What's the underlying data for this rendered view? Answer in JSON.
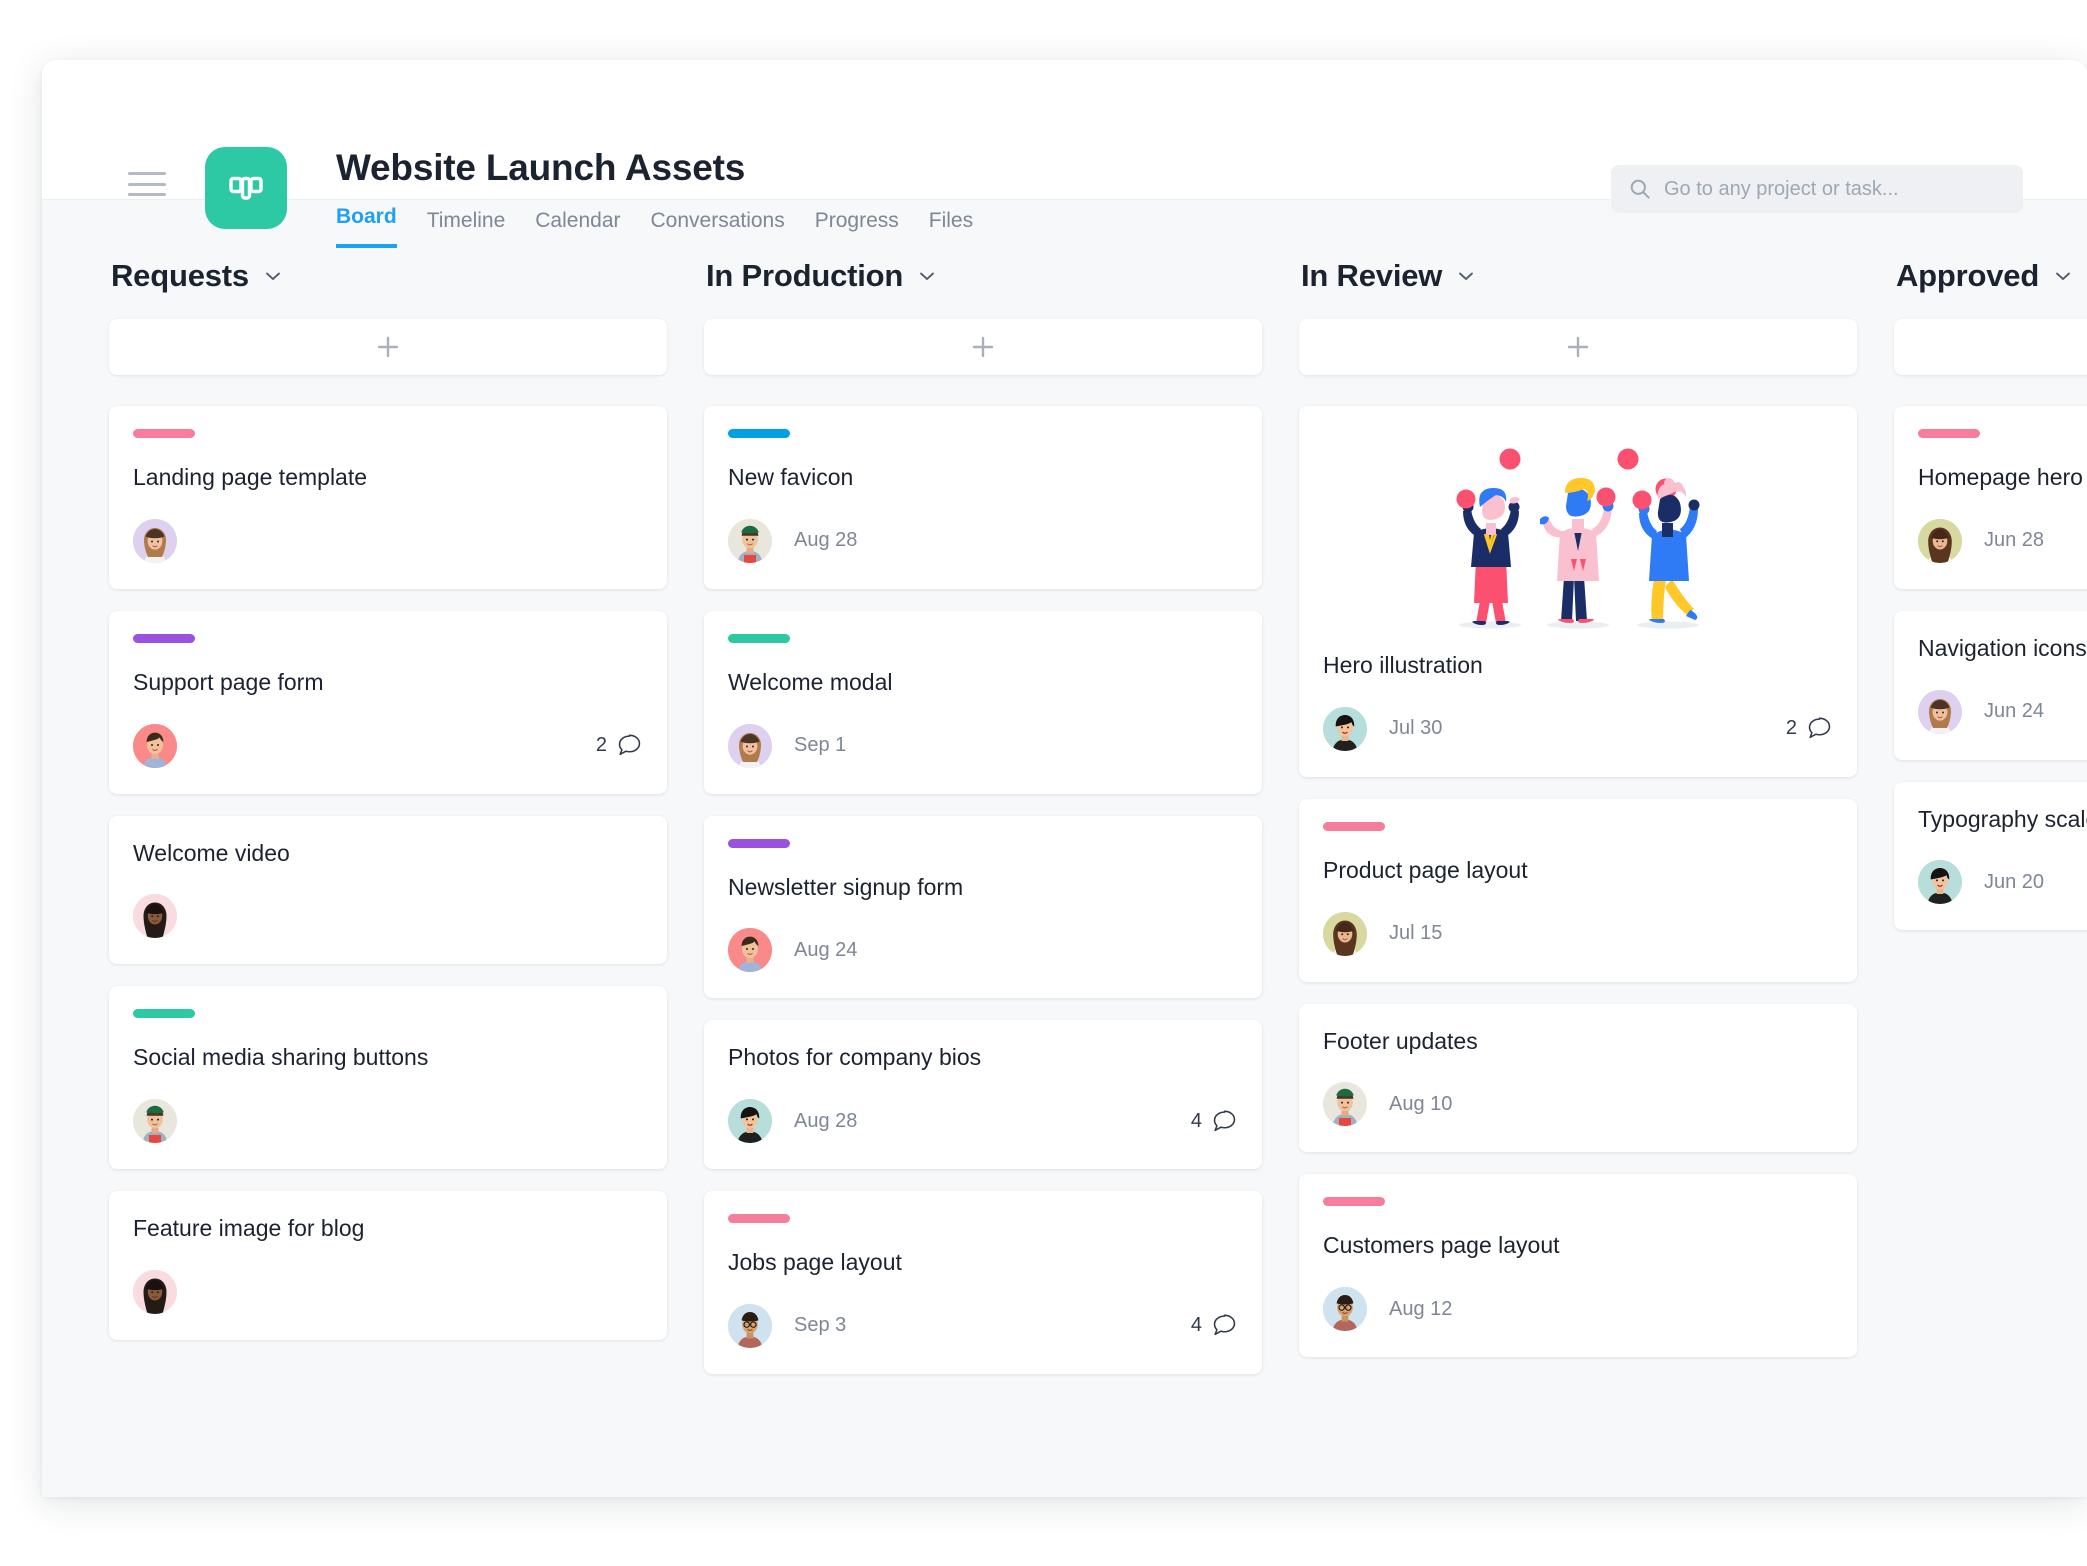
{
  "header": {
    "title": "Website Launch Assets",
    "menu_icon": "hamburger-icon",
    "project_icon": "board-icon",
    "tabs": [
      {
        "label": "Board",
        "active": true
      },
      {
        "label": "Timeline",
        "active": false
      },
      {
        "label": "Calendar",
        "active": false
      },
      {
        "label": "Conversations",
        "active": false
      },
      {
        "label": "Progress",
        "active": false
      },
      {
        "label": "Files",
        "active": false
      }
    ],
    "search": {
      "icon": "search-icon",
      "placeholder": "Go to any project or task...",
      "value": ""
    }
  },
  "colors": {
    "accent": "#1da1f2",
    "brand_green": "#2dc9a5",
    "tag_pink": "#f77e9b",
    "tag_purple": "#9b51e0",
    "tag_blue": "#00a0e3",
    "tag_teal": "#2dc9a5",
    "page_bg": "#f7f8fa",
    "text_primary": "#1c2330",
    "text_muted": "#7d8795"
  },
  "board": {
    "add_card_icon": "plus-icon",
    "columns": [
      {
        "name": "Requests",
        "menu_icon": "chevron-down-icon",
        "add_label": "+",
        "cards": [
          {
            "title": "Landing page template",
            "tag": "#f77e9b",
            "due": "",
            "comments": "",
            "avatar": "avatar-woman-bangs",
            "avatar_bg": "#ded1f0",
            "illustration": false
          },
          {
            "title": "Support page form",
            "tag": "#9b51e0",
            "due": "",
            "comments": "2",
            "avatar": "avatar-man-shirt",
            "avatar_bg": "#fa8a8a",
            "illustration": false
          },
          {
            "title": "Welcome video",
            "tag": "",
            "due": "",
            "comments": "",
            "avatar": "avatar-woman-dark-hair",
            "avatar_bg": "#fadbe0",
            "illustration": false
          },
          {
            "title": "Social media sharing buttons",
            "tag": "#2dc9a5",
            "due": "",
            "comments": "",
            "avatar": "avatar-person-green-cap",
            "avatar_bg": "#e9e7dd",
            "illustration": false
          },
          {
            "title": "Feature image for blog",
            "tag": "",
            "due": "",
            "comments": "",
            "avatar": "avatar-woman-dark-hair",
            "avatar_bg": "#fadbe0",
            "illustration": false
          }
        ]
      },
      {
        "name": "In Production",
        "menu_icon": "chevron-down-icon",
        "add_label": "+",
        "cards": [
          {
            "title": "New favicon",
            "tag": "#00a0e3",
            "due": "Aug 28",
            "comments": "",
            "avatar": "avatar-person-green-cap",
            "avatar_bg": "#e9e7dd",
            "illustration": false
          },
          {
            "title": "Welcome modal",
            "tag": "#2dc9a5",
            "due": "Sep 1",
            "comments": "",
            "avatar": "avatar-woman-bangs",
            "avatar_bg": "#ded1f0",
            "illustration": false
          },
          {
            "title": "Newsletter signup form",
            "tag": "#9b51e0",
            "due": "Aug 24",
            "comments": "",
            "avatar": "avatar-man-shirt",
            "avatar_bg": "#fa8a8a",
            "illustration": false
          },
          {
            "title": "Photos for company bios",
            "tag": "",
            "due": "Aug 28",
            "comments": "4",
            "avatar": "avatar-woman-short-hair",
            "avatar_bg": "#b8dedb",
            "illustration": false
          },
          {
            "title": "Jobs page layout",
            "tag": "#f77e9b",
            "due": "Sep 3",
            "comments": "4",
            "avatar": "avatar-man-glasses",
            "avatar_bg": "#cfe2f0",
            "illustration": false
          }
        ]
      },
      {
        "name": "In Review",
        "menu_icon": "chevron-down-icon",
        "add_label": "+",
        "cards": [
          {
            "title": "Hero illustration",
            "tag": "",
            "due": "Jul 30",
            "comments": "2",
            "avatar": "avatar-woman-short-hair",
            "avatar_bg": "#b8dedb",
            "illustration": true,
            "illustration_name": "three-people-juggling-illustration"
          },
          {
            "title": "Product page layout",
            "tag": "#f77e9b",
            "due": "Jul 15",
            "comments": "",
            "avatar": "avatar-woman-long-hair",
            "avatar_bg": "#d8d9a0",
            "illustration": false
          },
          {
            "title": "Footer updates",
            "tag": "",
            "due": "Aug 10",
            "comments": "",
            "avatar": "avatar-person-green-cap",
            "avatar_bg": "#e9e7dd",
            "illustration": false
          },
          {
            "title": "Customers page layout",
            "tag": "#f77e9b",
            "due": "Aug 12",
            "comments": "",
            "avatar": "avatar-man-glasses",
            "avatar_bg": "#cfe2f0",
            "illustration": false
          }
        ]
      },
      {
        "name": "Approved",
        "menu_icon": "chevron-down-icon",
        "add_label": "+",
        "cards": [
          {
            "title": "Homepage hero",
            "tag": "#f77e9b",
            "due": "Jun 28",
            "comments": "",
            "avatar": "avatar-woman-long-hair",
            "avatar_bg": "#d8d9a0",
            "illustration": false
          },
          {
            "title": "Navigation icons",
            "tag": "",
            "due": "Jun 24",
            "comments": "",
            "avatar": "avatar-woman-bangs",
            "avatar_bg": "#ded1f0",
            "illustration": false
          },
          {
            "title": "Typography scale",
            "tag": "",
            "due": "Jun 20",
            "comments": "",
            "avatar": "avatar-woman-short-hair",
            "avatar_bg": "#b8dedb",
            "illustration": false
          }
        ]
      }
    ]
  }
}
